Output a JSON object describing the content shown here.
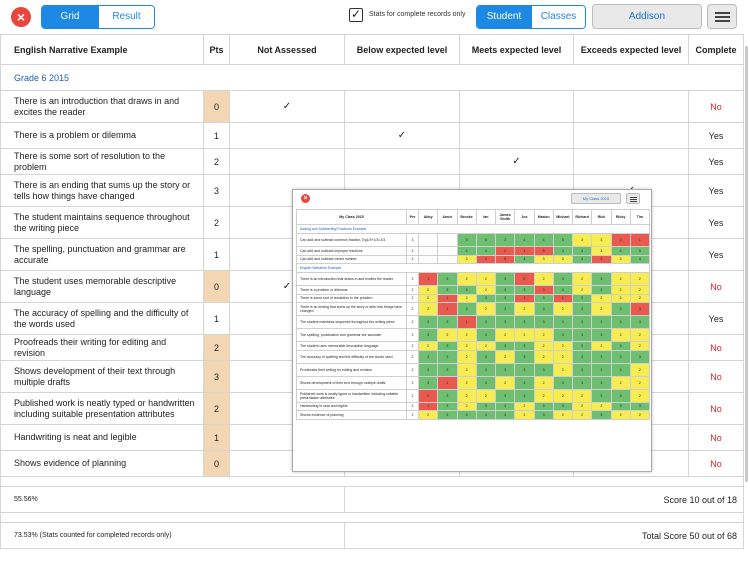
{
  "toolbar": {
    "close_icon": "×",
    "view_tabs": [
      "Grid",
      "Result"
    ],
    "stats_checkbox_label": "Stats for complete records only",
    "stats_checked": true,
    "mode_tabs": [
      "Student",
      "Classes"
    ],
    "user_button": "Addison"
  },
  "table": {
    "headers": [
      "English Narrative Example",
      "Pts",
      "Not Assessed",
      "Below expected level",
      "Meets expected level",
      "Exceeds expected level",
      "Complete"
    ],
    "section": "Grade 6 2015",
    "rows": [
      {
        "desc": "There is an introduction that draws in and excites the reader",
        "pts": "0",
        "mark": 0,
        "complete": "No"
      },
      {
        "desc": "There is a problem or dilemma",
        "pts": "1",
        "mark": 1,
        "complete": "Yes"
      },
      {
        "desc": "There is some sort of resolution to the problem",
        "pts": "2",
        "mark": 2,
        "complete": "Yes"
      },
      {
        "desc": "There is an ending that sums up the story or tells how things have changed",
        "pts": "3",
        "mark": 3,
        "complete": "Yes"
      },
      {
        "desc": "The student maintains sequence throughout the writing piece",
        "pts": "2",
        "mark": 2,
        "complete": "Yes"
      },
      {
        "desc": "The spelling, punctuation and grammar are accurate",
        "pts": "1",
        "mark": 1,
        "complete": "Yes"
      },
      {
        "desc": "The student uses memorable descriptive language",
        "pts": "0",
        "mark": 0,
        "complete": "No"
      },
      {
        "desc": "The accuracy of spelling and the difficulty of the words used",
        "pts": "1",
        "mark": 1,
        "complete": "Yes"
      },
      {
        "desc": "Proofreads their writing for editing and revision",
        "pts": "2",
        "mark": -1,
        "complete": "No"
      },
      {
        "desc": "Shows development of their text through multiple drafts",
        "pts": "3",
        "mark": -1,
        "complete": "No"
      },
      {
        "desc": "Published work is neatly typed or handwritten including suitable presentation attributes",
        "pts": "2",
        "mark": -1,
        "complete": "No"
      },
      {
        "desc": "Handwriting is neat and legible",
        "pts": "1",
        "mark": -1,
        "complete": "No"
      },
      {
        "desc": "Shows evidence of planning",
        "pts": "0",
        "mark": -1,
        "complete": "No"
      }
    ],
    "check_glyph": "✓",
    "summary_pct": "55.56%",
    "summary_score": "Score 10 out of 18",
    "total_pct": "73.53% (Stats counted for completed records only)",
    "total_score": "Total Score 50 out of 68"
  },
  "inset": {
    "close_icon": "×",
    "user_button": "My Class 2015",
    "header_title": "My Class 2015",
    "students": [
      "Per",
      "Abby",
      "Annie",
      "Brooke",
      "Ian",
      "James Smith",
      "Joe",
      "Marion",
      "Michael",
      "Richard",
      "Rick",
      "Ricky",
      "Tim"
    ],
    "sections": [
      {
        "name": "Adding and Subtracting Fractions Example",
        "rows": [
          {
            "desc": "Can add and subtract common fraction. Eg1/3+1/3=2/3",
            "per": "3",
            "cells": [
              "",
              "",
              "5g",
              "5g",
              "3g",
              "4g",
              "4g",
              "5g",
              "3y",
              "3y",
              "2r",
              "1r"
            ]
          },
          {
            "desc": "Can add and subtract improper fractions",
            "per": "3",
            "cells": [
              "",
              "",
              "4g",
              "4g",
              "2r",
              "1r",
              "5r",
              "4g",
              "4g",
              "3y",
              "4g",
              "5g"
            ]
          },
          {
            "desc": "Can add and subtract mixed number",
            "per": "3",
            "cells": [
              "",
              "",
              "3y",
              "2r",
              "5r",
              "4g",
              "3y",
              "3y",
              "4g",
              "2r",
              "3y",
              "4g"
            ]
          }
        ]
      },
      {
        "name": "English Narrative Example",
        "rows": [
          {
            "desc": "There is an introduction that draws in and excites the reader",
            "per": "2",
            "cells": [
              "1r",
              "3g",
              "2y",
              "2y",
              "3g",
              "0r",
              "2y",
              "3g",
              "2y",
              "3g",
              "2y",
              "2y"
            ]
          },
          {
            "desc": "There is a problem or dilemma",
            "per": "2",
            "cells": [
              "2y",
              "3g",
              "3g",
              "2y",
              "3g",
              "3g",
              "0r",
              "3g",
              "2y",
              "3g",
              "2y",
              "2y"
            ]
          },
          {
            "desc": "There is some sort of resolution to the problem",
            "per": "2",
            "cells": [
              "2y",
              "1r",
              "2y",
              "3g",
              "3g",
              "1r",
              "3g",
              "1r",
              "3g",
              "2y",
              "2y",
              "2y"
            ]
          },
          {
            "desc": "There is an ending that sums up the story or tells how things have changed",
            "per": "2",
            "cells": [
              "2y",
              "1r",
              "3g",
              "2y",
              "3g",
              "2y",
              "3g",
              "2y",
              "3g",
              "2y",
              "3g",
              "3r"
            ]
          },
          {
            "desc": "The student maintains sequence throughout the writing piece",
            "per": "2",
            "cells": [
              "3g",
              "3g",
              "1r",
              "3g",
              "3g",
              "3g",
              "3g",
              "3g",
              "3g",
              "3g",
              "3g",
              "3g"
            ]
          },
          {
            "desc": "The spelling, punctuation and grammar are accurate",
            "per": "2",
            "cells": [
              "3g",
              "2y",
              "2y",
              "3g",
              "2y",
              "2y",
              "2y",
              "3g",
              "3g",
              "3g",
              "2y",
              "2y"
            ]
          },
          {
            "desc": "The student uses memorable descriptive language",
            "per": "2",
            "cells": [
              "2y",
              "3g",
              "2y",
              "2y",
              "3g",
              "3g",
              "2y",
              "2y",
              "3g",
              "2y",
              "3g",
              "2y"
            ]
          },
          {
            "desc": "The accuracy of spelling and the difficulty of the words used",
            "per": "2",
            "cells": [
              "3g",
              "3g",
              "2y",
              "3g",
              "2y",
              "3g",
              "2y",
              "2y",
              "3g",
              "3g",
              "3g",
              "3g"
            ]
          },
          {
            "desc": "Proofreads their writing for editing and revision",
            "per": "2",
            "cells": [
              "3g",
              "3g",
              "2y",
              "3g",
              "3g",
              "3g",
              "3g",
              "2y",
              "3g",
              "3g",
              "3g",
              "2y"
            ]
          },
          {
            "desc": "Shows development of their text through multiple drafts",
            "per": "2",
            "cells": [
              "3g",
              "1r",
              "2y",
              "3g",
              "2y",
              "3g",
              "2y",
              "3g",
              "3g",
              "3g",
              "2y",
              "2y"
            ]
          },
          {
            "desc": "Published work is neatly typed or handwritten including suitable presentation attributes",
            "per": "2",
            "cells": [
              "0r",
              "3g",
              "2y",
              "2y",
              "3g",
              "3g",
              "2y",
              "2y",
              "2y",
              "3g",
              "3g",
              "2y"
            ]
          },
          {
            "desc": "Handwriting is neat and legible",
            "per": "2",
            "cells": [
              "1r",
              "3g",
              "2y",
              "3g",
              "3g",
              "2y",
              "3g",
              "3g",
              "2y",
              "2y",
              "3g",
              "3g"
            ]
          },
          {
            "desc": "Shows evidence of planning",
            "per": "2",
            "cells": [
              "2y",
              "3g",
              "3g",
              "3g",
              "3g",
              "2y",
              "3g",
              "2y",
              "2y",
              "3g",
              "2y",
              "2y"
            ]
          }
        ]
      }
    ]
  },
  "colors": {
    "accent": "#1e88e5",
    "orange_pts": "#f3d6b3",
    "no_red": "#e02020",
    "red": "#e85a4f",
    "yellow": "#f7ec52",
    "green": "#6fbf73"
  }
}
